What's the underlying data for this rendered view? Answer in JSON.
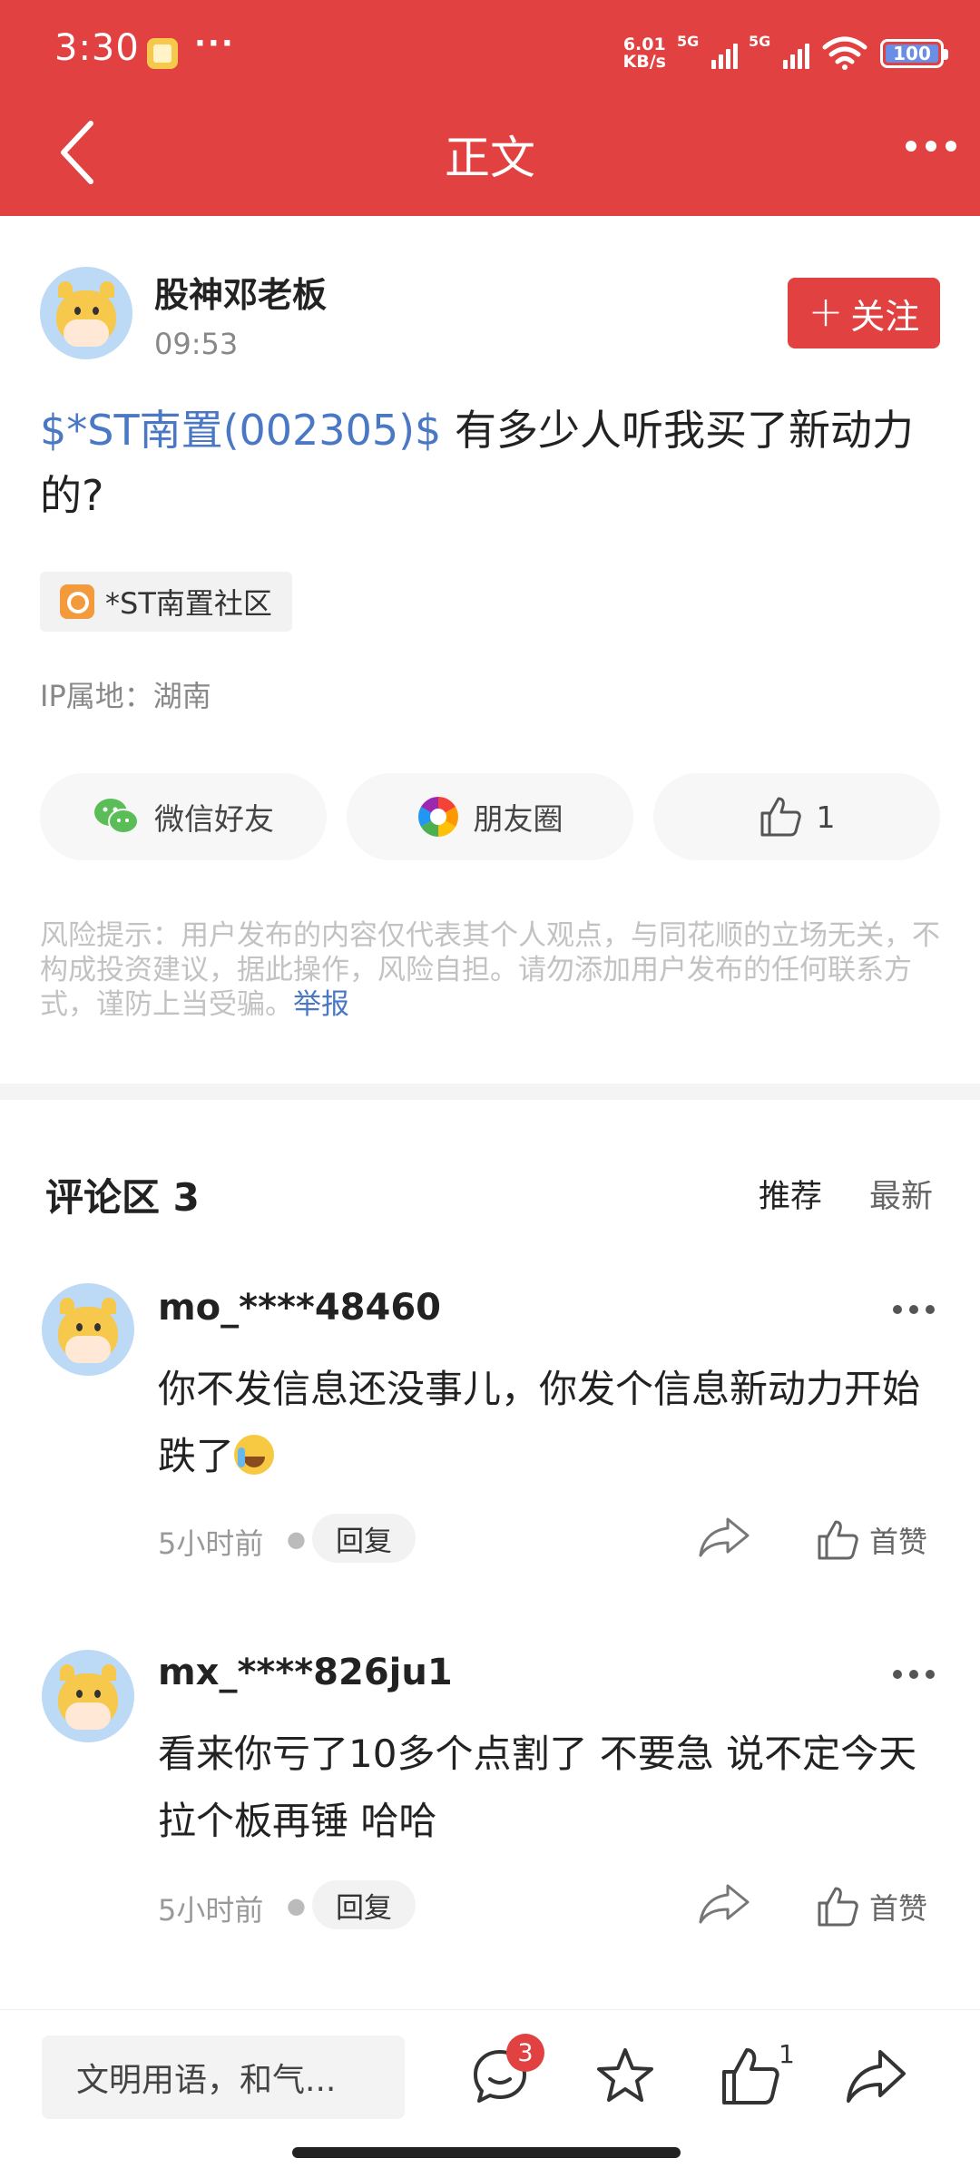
{
  "status_bar": {
    "time": "3:30",
    "overflow": "···",
    "net_speed_value": "6.01",
    "net_speed_unit": "KB/s",
    "sim1": "5G",
    "sim2": "5G",
    "wifi_label": "6",
    "battery": "100"
  },
  "nav": {
    "title": "正文",
    "back_icon": "back-arrow-icon",
    "more_icon": "more-dots-icon"
  },
  "post": {
    "author": "股神邓老板",
    "time": "09:53",
    "follow_label": "关注",
    "stock_tag": "$*ST南置(002305)$",
    "body": " 有多少人听我买了新动力的?",
    "community": "*ST南置社区",
    "ip_location": "IP属地：湖南"
  },
  "share": {
    "wechat_label": "微信好友",
    "moments_label": "朋友圈",
    "like_count": "1"
  },
  "risk": {
    "text": "风险提示：用户发布的内容仅代表其个人观点，与同花顺的立场无关，不构成投资建议，据此操作，风险自担。请勿添加用户发布的任何联系方式，谨防上当受骗。",
    "report_label": "举报"
  },
  "comments_section": {
    "title": "评论区 3",
    "sort_recommend": "推荐",
    "sort_latest": "最新",
    "items": [
      {
        "name": "mo_****48460",
        "text": "你不发信息还没事儿，你发个信息新动力开始跌了",
        "time": "5小时前",
        "reply_label": "回复",
        "like_label": "首赞"
      },
      {
        "name": "mx_****826ju1",
        "text": "看来你亏了10多个点割了 不要急 说不定今天拉个板再锤 哈哈",
        "time": "5小时前",
        "reply_label": "回复",
        "like_label": "首赞"
      }
    ]
  },
  "bottom_bar": {
    "input_placeholder": "文明用语，和气...",
    "comment_badge": "3",
    "like_count": "1"
  },
  "colors": {
    "brand_red": "#e14140",
    "link_blue": "#4a78c4"
  }
}
